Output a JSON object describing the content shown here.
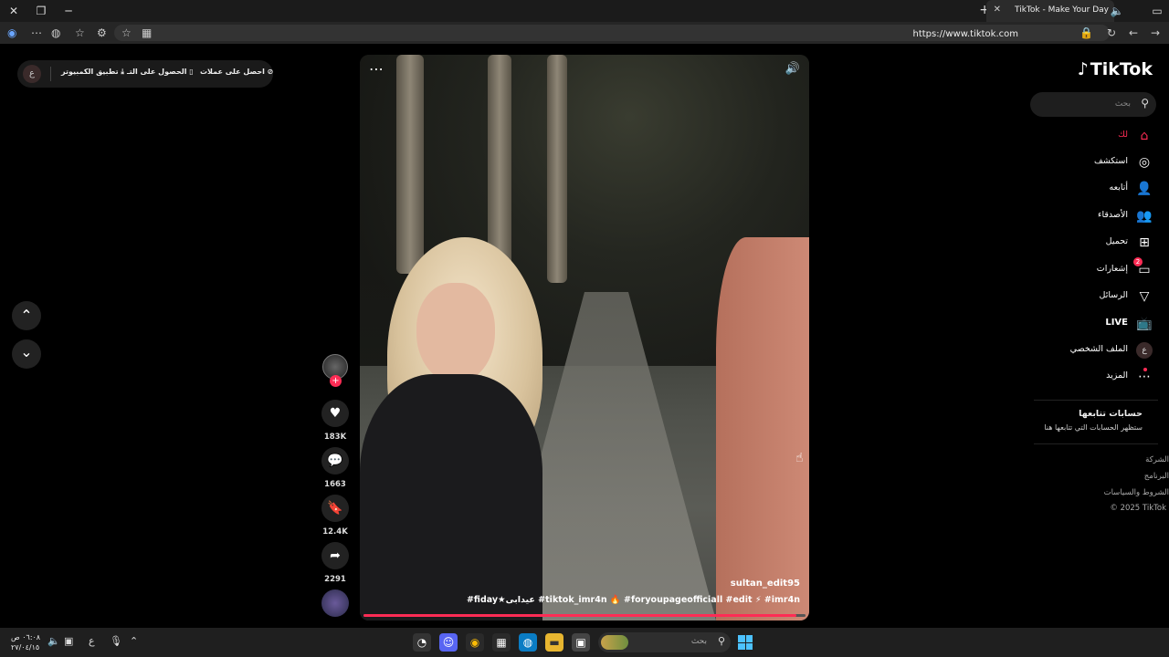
{
  "browser": {
    "tab_title": "TikTok - Make Your Day",
    "url": "https://www.tiktok.com"
  },
  "topbar": {
    "avatar_letter": "ع",
    "get_coins": "احصل على عملات",
    "get_app": "الحصول على التـ",
    "pc_app": "تطبيق الكمبيوتر"
  },
  "video": {
    "username": "sultan_edit95",
    "tags": "#fiday★عيدابى #tiktok_imr4n 🔥 #foryoupageofficiall #edit ⚡ #imr4n",
    "progress": 0.98
  },
  "actions": {
    "likes": "183K",
    "comments": "1663",
    "saves": "12.4K",
    "shares": "2291"
  },
  "sidebar": {
    "logo": "TikTok",
    "search_placeholder": "بحث",
    "items": [
      {
        "label": "لك",
        "icon": "home-icon"
      },
      {
        "label": "استكشف",
        "icon": "compass-icon"
      },
      {
        "label": "أتابعه",
        "icon": "user-check-icon"
      },
      {
        "label": "الأصدقاء",
        "icon": "friends-icon"
      },
      {
        "label": "تحميل",
        "icon": "upload-icon"
      },
      {
        "label": "إشعارات",
        "icon": "inbox-icon",
        "badge": "2"
      },
      {
        "label": "الرسائل",
        "icon": "send-icon"
      },
      {
        "label": "LIVE",
        "icon": "live-icon"
      },
      {
        "label": "الملف الشخصي",
        "icon": "profile-icon",
        "avatar_letter": "ع"
      },
      {
        "label": "المزيد",
        "icon": "more-icon"
      }
    ],
    "following_title": "حسابات تتابعها",
    "following_sub": "ستظهر الحسابات التي تتابعها هنا",
    "footer": [
      "الشركة",
      "البرنامج",
      "الشروط والسياسات",
      "© 2025 TikTok"
    ]
  },
  "taskbar": {
    "time": "٠٦:٠٨ ص",
    "date": "٢٧/٠٤/١٥",
    "lang": "ع",
    "search_placeholder": "بحث"
  },
  "colors": {
    "accent": "#fe2c55",
    "background": "#000000"
  }
}
